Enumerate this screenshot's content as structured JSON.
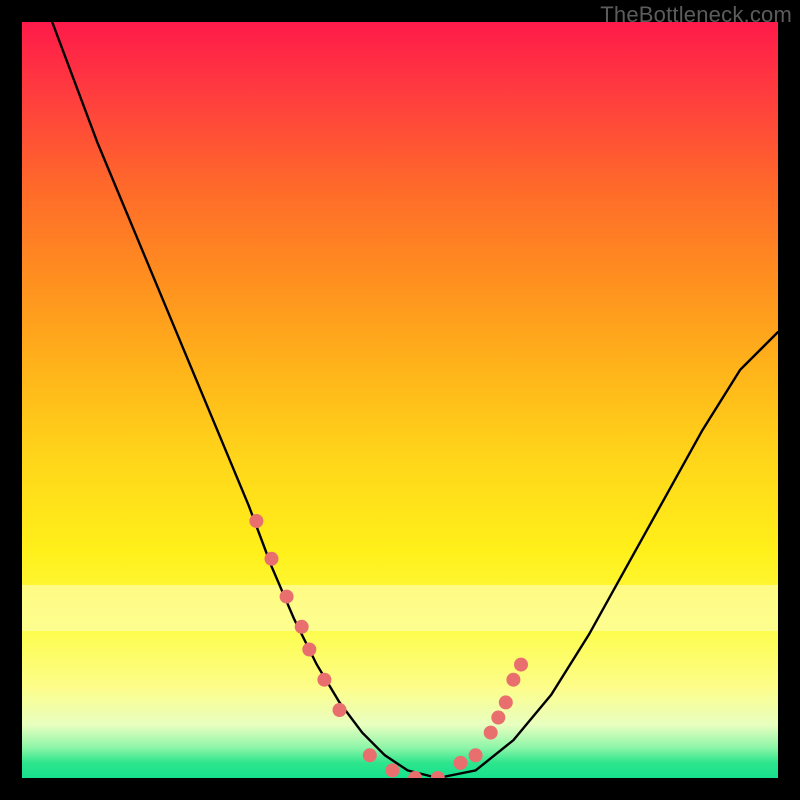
{
  "watermark": "TheBottleneck.com",
  "chart_data": {
    "type": "line",
    "title": "",
    "xlabel": "",
    "ylabel": "",
    "xlim": [
      0,
      100
    ],
    "ylim": [
      0,
      100
    ],
    "grid": false,
    "legend": false,
    "series": [
      {
        "name": "bottleneck-curve",
        "x": [
          4,
          10,
          15,
          20,
          25,
          30,
          33,
          36,
          39,
          42,
          45,
          48,
          51,
          55,
          60,
          65,
          70,
          75,
          80,
          85,
          90,
          95,
          100
        ],
        "y": [
          100,
          84,
          72,
          60,
          48,
          36,
          28,
          21,
          15,
          10,
          6,
          3,
          1,
          0,
          1,
          5,
          11,
          19,
          28,
          37,
          46,
          54,
          59
        ]
      }
    ],
    "markers": {
      "name": "highlight-points",
      "color": "#e96f6f",
      "x": [
        31,
        33,
        35,
        37,
        38,
        40,
        42,
        46,
        49,
        52,
        55,
        58,
        60,
        62,
        63,
        64,
        65,
        66
      ],
      "y": [
        34,
        29,
        24,
        20,
        17,
        13,
        9,
        3,
        1,
        0,
        0,
        2,
        3,
        6,
        8,
        10,
        13,
        15
      ]
    },
    "background_gradient": {
      "top": "#ff1a4a",
      "mid": "#fff01a",
      "bottom": "#17e08d"
    }
  }
}
